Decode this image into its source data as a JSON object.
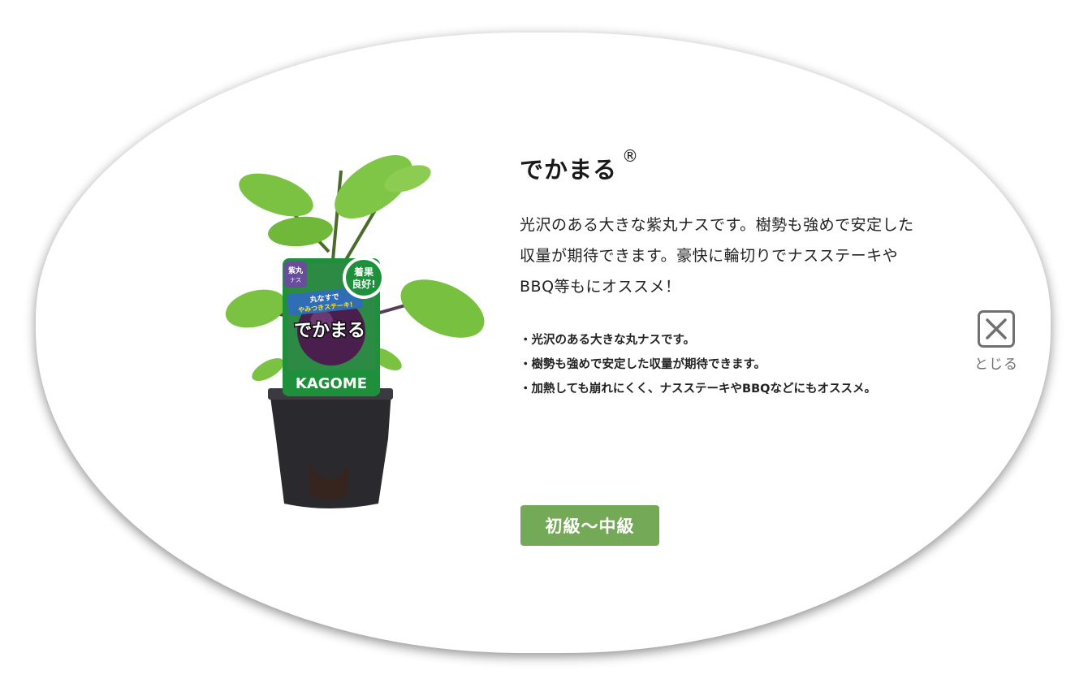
{
  "product": {
    "title": "でかまる",
    "registered_mark": "®",
    "description": "光沢のある大きな紫丸ナスです。樹勢も強めで安定した収量が期待できます。豪快に輪切りでナスステーキやBBQ等もにオススメ！",
    "features": [
      "光沢のある大きな丸ナスです。",
      "樹勢も強めで安定した収量が期待できます。",
      "加熱しても崩れにくく、ナスステーキやBBQなどにもオススメ。"
    ],
    "level": "初級〜中級"
  },
  "package_label": {
    "category": "紫丸ナス",
    "badge": "着果良好！",
    "tagline": "丸なすでやみつきステーキ！",
    "name": "でかまる",
    "brand": "KAGOME"
  },
  "close": {
    "label": "とじる",
    "icon": "close-icon"
  },
  "colors": {
    "level_badge": "#74a957",
    "close": "#707070",
    "brand_green": "#1e8f3a"
  }
}
